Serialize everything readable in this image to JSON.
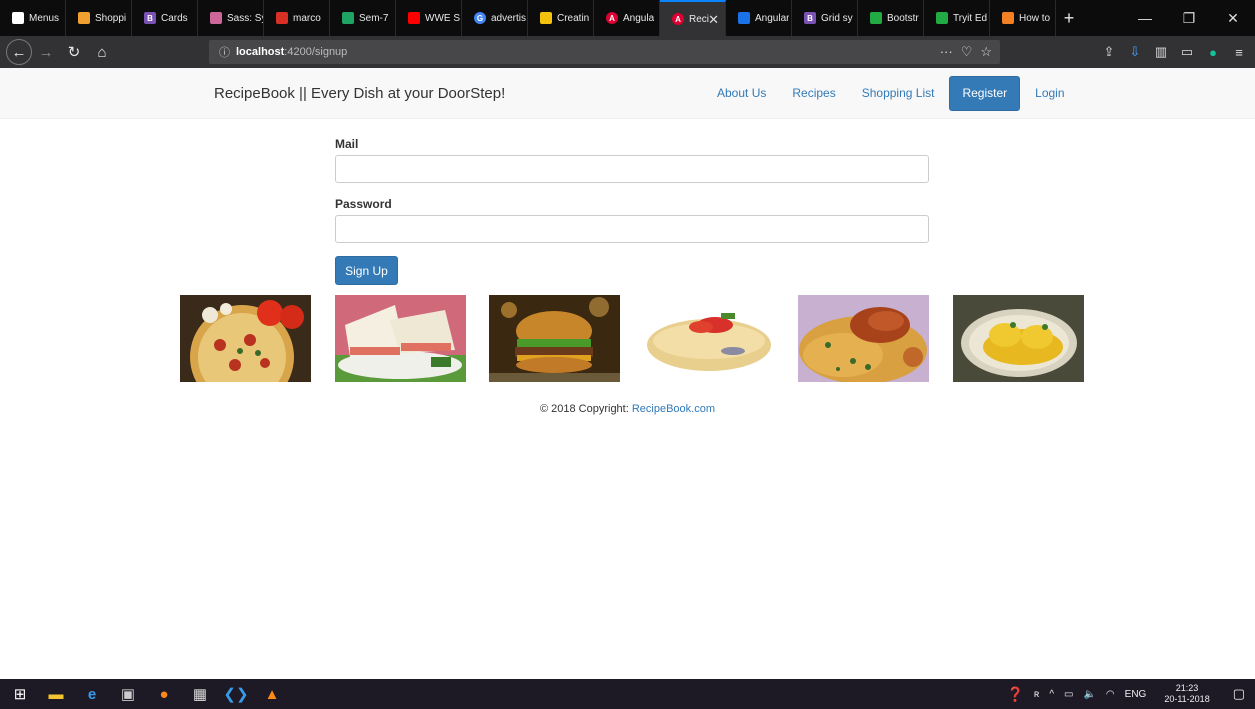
{
  "browser": {
    "tabs": [
      {
        "label": "Menus",
        "color": "#ffffff"
      },
      {
        "label": "Shoppi",
        "color": "#f0a030"
      },
      {
        "label": "Cards",
        "color": "#7952b3"
      },
      {
        "label": "Sass: Sy",
        "color": "#cd6799"
      },
      {
        "label": "marco",
        "color": "#d93025"
      },
      {
        "label": "Sem-7",
        "color": "#1fa463"
      },
      {
        "label": "WWE S",
        "color": "#ff0000"
      },
      {
        "label": "advertis",
        "color": "#4285f4"
      },
      {
        "label": "Creatin",
        "color": "#f4c20d"
      },
      {
        "label": "Angula",
        "color": "#dd0031"
      },
      {
        "label": "Reci",
        "color": "#dd0031"
      },
      {
        "label": "Angular",
        "color": "#1a73e8"
      },
      {
        "label": "Grid sy",
        "color": "#7952b3"
      },
      {
        "label": "Bootstr",
        "color": "#22aa44"
      },
      {
        "label": "Tryit Ed",
        "color": "#22aa44"
      },
      {
        "label": "How to",
        "color": "#f48024"
      }
    ],
    "url": {
      "host": "localhost",
      "path": ":4200/signup"
    }
  },
  "nav": {
    "brand": "RecipeBook || Every Dish at your DoorStep!",
    "links": [
      "About Us",
      "Recipes",
      "Shopping List",
      "Register",
      "Login"
    ],
    "active": "Register"
  },
  "form": {
    "mail_label": "Mail",
    "password_label": "Password",
    "submit_label": "Sign Up"
  },
  "images": [
    "pizza",
    "sandwich",
    "burger",
    "taco",
    "biryani",
    "eggs-benedict"
  ],
  "footer": {
    "text": "© 2018 Copyright: ",
    "link": "RecipeBook.com"
  },
  "taskbar": {
    "lang": "ENG",
    "time": "21:23",
    "date": "20-11-2018"
  }
}
